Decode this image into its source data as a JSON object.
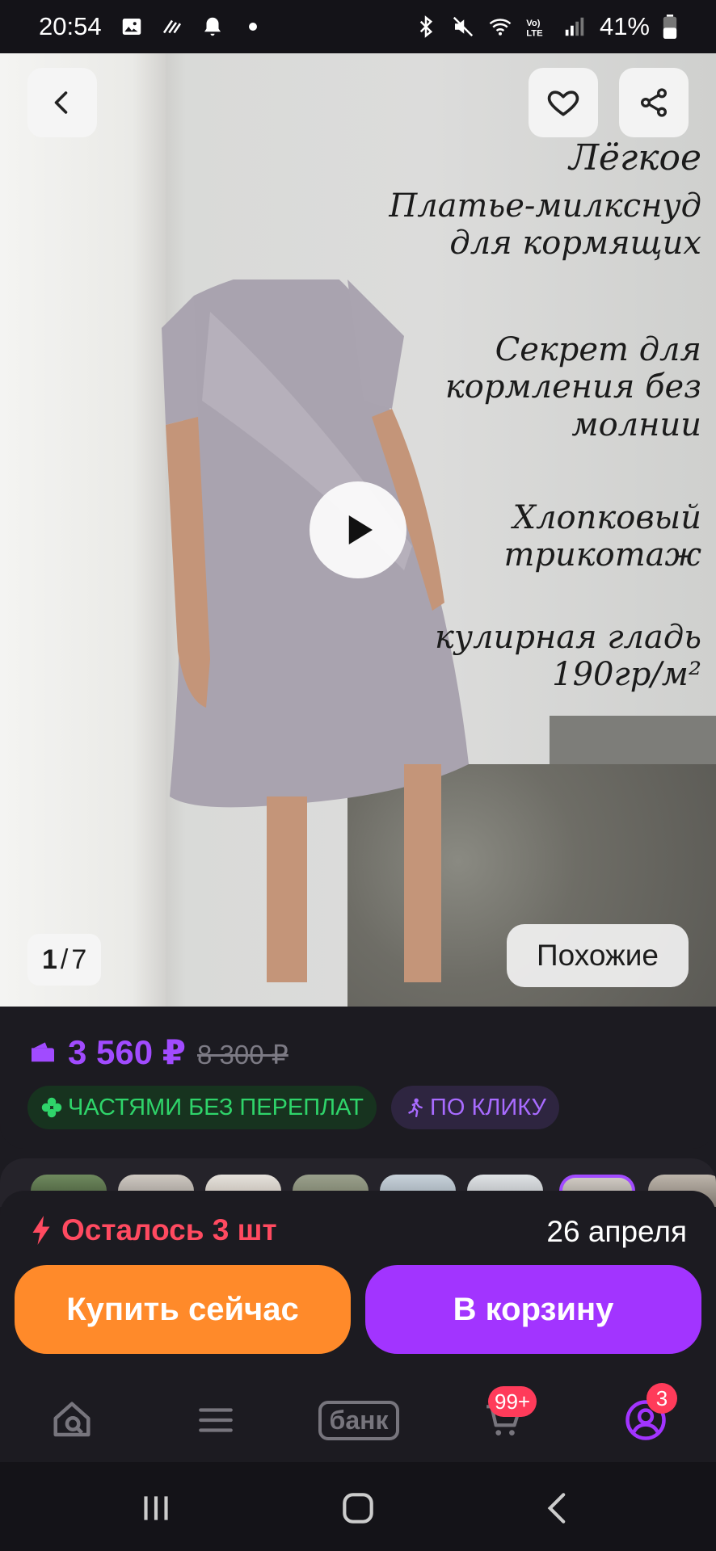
{
  "status_bar": {
    "time": "20:54",
    "battery": "41%"
  },
  "hero": {
    "caption_title": "Лёгкое",
    "caption_subtitle": [
      "Платье-милкснуд",
      "для кормящих"
    ],
    "caption_secret": [
      "Секрет для",
      "кормления без",
      "молнии"
    ],
    "caption_fabric": [
      "Хлопковый",
      "трикотаж"
    ],
    "caption_density": [
      "кулирная гладь",
      "190гр/м²"
    ],
    "counter_current": "1",
    "counter_separator": "/",
    "counter_total": "7",
    "similar_label": "Похожие"
  },
  "price": {
    "current": "3 560 ₽",
    "old": "8 300 ₽",
    "badge_installment": "ЧАСТЯМИ БЕЗ ПЕРЕПЛАТ",
    "badge_click": "ПО КЛИКУ"
  },
  "purchase": {
    "stock": "Осталось 3 шт",
    "delivery_date": "26 апреля",
    "buy_now": "Купить сейчас",
    "add_to_cart": "В корзину"
  },
  "bottom_nav": {
    "bank_label": "банк",
    "cart_badge": "99+",
    "profile_badge": "3"
  },
  "colors": {
    "accent_purple": "#a234ff",
    "buy_orange": "#ff8a2a",
    "stock_red": "#ff4a60",
    "installment_green": "#2fd46a"
  }
}
